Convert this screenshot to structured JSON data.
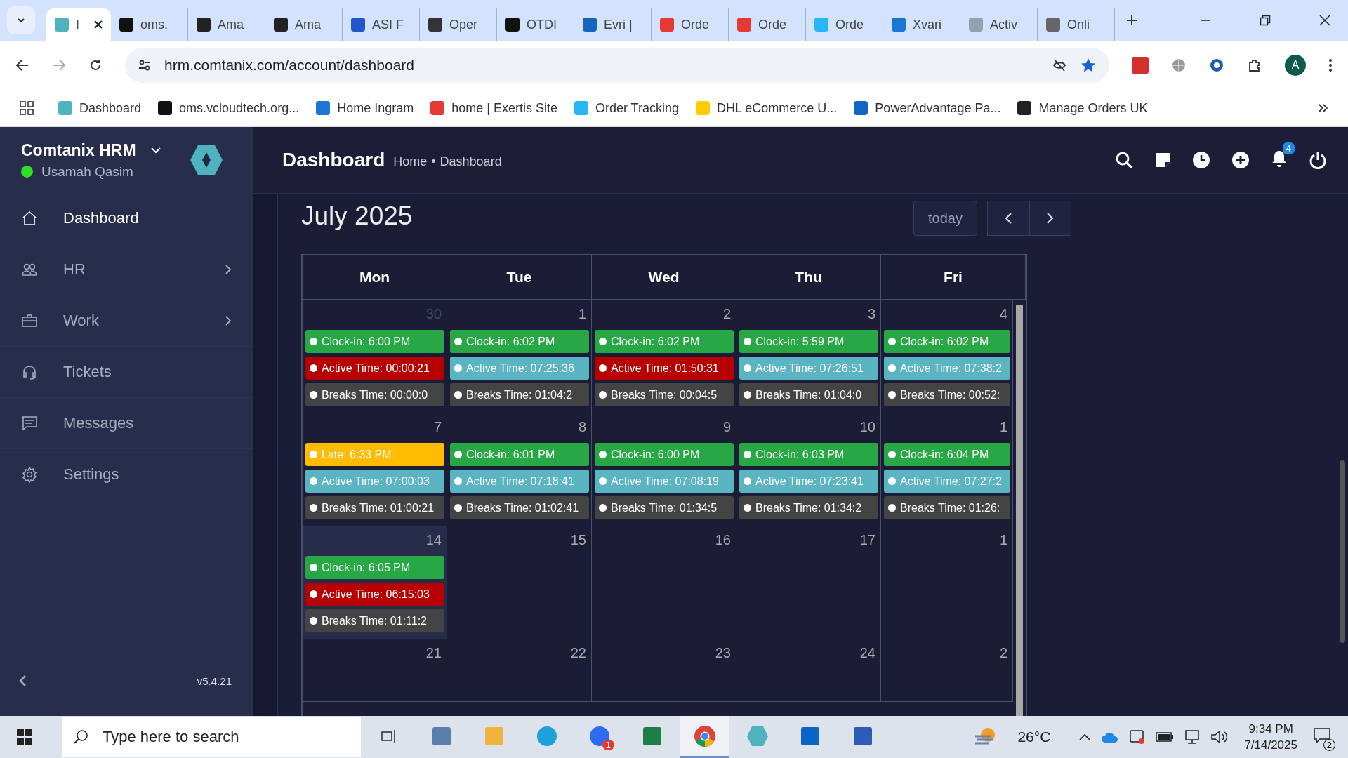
{
  "browser": {
    "tabs": [
      {
        "title": "I",
        "selected": true
      },
      {
        "title": "oms.",
        "selected": false
      },
      {
        "title": "Ama",
        "selected": false
      },
      {
        "title": "Ama",
        "selected": false
      },
      {
        "title": "ASI F",
        "selected": false
      },
      {
        "title": "Oper",
        "selected": false
      },
      {
        "title": "OTDI",
        "selected": false
      },
      {
        "title": "Evri |",
        "selected": false
      },
      {
        "title": "Orde",
        "selected": false
      },
      {
        "title": "Orde",
        "selected": false
      },
      {
        "title": "Orde",
        "selected": false
      },
      {
        "title": "Xvari",
        "selected": false
      },
      {
        "title": "Activ",
        "selected": false
      },
      {
        "title": "Onli",
        "selected": false
      }
    ],
    "address": "hrm.comtanix.com/account/dashboard",
    "profile": "A",
    "bookmarks": [
      "Dashboard",
      "oms.vcloudtech.org...",
      "Home Ingram",
      "home | Exertis Site",
      "Order Tracking",
      "DHL eCommerce U...",
      "PowerAdvantage Pa...",
      "Manage Orders UK"
    ]
  },
  "sidebar": {
    "brand": "Comtanix HRM",
    "user": "Usamah Qasim",
    "online": true,
    "items": [
      {
        "label": "Dashboard",
        "kind": "home",
        "selected": true,
        "submenu": false
      },
      {
        "label": "HR",
        "kind": "people",
        "selected": false,
        "submenu": true
      },
      {
        "label": "Work",
        "kind": "briefcase",
        "selected": false,
        "submenu": true
      },
      {
        "label": "Tickets",
        "kind": "headset",
        "selected": false,
        "submenu": false
      },
      {
        "label": "Messages",
        "kind": "chat",
        "selected": false,
        "submenu": false
      },
      {
        "label": "Settings",
        "kind": "gear",
        "selected": false,
        "submenu": false
      }
    ],
    "version": "v5.4.21"
  },
  "header": {
    "title": "Dashboard",
    "breadcrumb": [
      "Home",
      "•",
      "Dashboard"
    ],
    "notification_count": "4"
  },
  "calendar": {
    "title": "July 2025",
    "today_button": "today",
    "weekdays": [
      "Mon",
      "Tue",
      "Wed",
      "Thu",
      "Fri"
    ],
    "weeks": [
      [
        {
          "day": "30",
          "outside": true,
          "today": false,
          "events": [
            {
              "text": "Clock-in: 6:00 PM",
              "color": "#28a745"
            },
            {
              "text": "Active Time: 00:00:21",
              "color": "#b70000"
            },
            {
              "text": "Breaks Time: 00:00:0",
              "color": "#444444"
            }
          ]
        },
        {
          "day": "1",
          "outside": false,
          "today": false,
          "events": [
            {
              "text": "Clock-in: 6:02 PM",
              "color": "#28a745"
            },
            {
              "text": "Active Time: 07:25:36",
              "color": "#5ab4c2"
            },
            {
              "text": "Breaks Time: 01:04:2",
              "color": "#444444"
            }
          ]
        },
        {
          "day": "2",
          "outside": false,
          "today": false,
          "events": [
            {
              "text": "Clock-in: 6:02 PM",
              "color": "#28a745"
            },
            {
              "text": "Active Time: 01:50:31",
              "color": "#b70000"
            },
            {
              "text": "Breaks Time: 00:04:5",
              "color": "#444444"
            }
          ]
        },
        {
          "day": "3",
          "outside": false,
          "today": false,
          "events": [
            {
              "text": "Clock-in: 5:59 PM",
              "color": "#28a745"
            },
            {
              "text": "Active Time: 07:26:51",
              "color": "#5ab4c2"
            },
            {
              "text": "Breaks Time: 01:04:0",
              "color": "#444444"
            }
          ]
        },
        {
          "day": "4",
          "outside": false,
          "today": false,
          "events": [
            {
              "text": "Clock-in: 6:02 PM",
              "color": "#28a745"
            },
            {
              "text": "Active Time: 07:38:2",
              "color": "#5ab4c2"
            },
            {
              "text": "Breaks Time: 00:52:",
              "color": "#444444"
            }
          ]
        }
      ],
      [
        {
          "day": "7",
          "outside": false,
          "today": false,
          "events": [
            {
              "text": "Late: 6:33 PM",
              "color": "#ffbb00"
            },
            {
              "text": "Active Time: 07:00:03",
              "color": "#5ab4c2"
            },
            {
              "text": "Breaks Time: 01:00:21",
              "color": "#444444"
            }
          ]
        },
        {
          "day": "8",
          "outside": false,
          "today": false,
          "events": [
            {
              "text": "Clock-in: 6:01 PM",
              "color": "#28a745"
            },
            {
              "text": "Active Time: 07:18:41",
              "color": "#5ab4c2"
            },
            {
              "text": "Breaks Time: 01:02:41",
              "color": "#444444"
            }
          ]
        },
        {
          "day": "9",
          "outside": false,
          "today": false,
          "events": [
            {
              "text": "Clock-in: 6:00 PM",
              "color": "#28a745"
            },
            {
              "text": "Active Time: 07:08:19",
              "color": "#5ab4c2"
            },
            {
              "text": "Breaks Time: 01:34:5",
              "color": "#444444"
            }
          ]
        },
        {
          "day": "10",
          "outside": false,
          "today": false,
          "events": [
            {
              "text": "Clock-in: 6:03 PM",
              "color": "#28a745"
            },
            {
              "text": "Active Time: 07:23:41",
              "color": "#5ab4c2"
            },
            {
              "text": "Breaks Time: 01:34:2",
              "color": "#444444"
            }
          ]
        },
        {
          "day": "1",
          "outside": false,
          "today": false,
          "events": [
            {
              "text": "Clock-in: 6:04 PM",
              "color": "#28a745"
            },
            {
              "text": "Active Time: 07:27:2",
              "color": "#5ab4c2"
            },
            {
              "text": "Breaks Time: 01:26:",
              "color": "#444444"
            }
          ]
        }
      ],
      [
        {
          "day": "14",
          "outside": false,
          "today": true,
          "events": [
            {
              "text": "Clock-in: 6:05 PM",
              "color": "#28a745"
            },
            {
              "text": "Active Time: 06:15:03",
              "color": "#b70000"
            },
            {
              "text": "Breaks Time: 01:11:2",
              "color": "#444444"
            }
          ]
        },
        {
          "day": "15",
          "outside": false,
          "today": false
        },
        {
          "day": "16",
          "outside": false,
          "today": false
        },
        {
          "day": "17",
          "outside": false,
          "today": false
        },
        {
          "day": "1",
          "outside": false,
          "today": false
        }
      ],
      [
        {
          "day": "21",
          "outside": false,
          "today": false
        },
        {
          "day": "22",
          "outside": false,
          "today": false
        },
        {
          "day": "23",
          "outside": false,
          "today": false
        },
        {
          "day": "24",
          "outside": false,
          "today": false
        },
        {
          "day": "2",
          "outside": false,
          "today": false
        }
      ]
    ]
  },
  "taskbar": {
    "search_placeholder": "Type here to search",
    "apps": [
      {
        "kind": "task-view",
        "selected": false
      },
      {
        "kind": "calculator",
        "selected": false
      },
      {
        "kind": "folder",
        "selected": false
      },
      {
        "kind": "edge",
        "selected": false
      },
      {
        "kind": "video",
        "selected": false,
        "badge": "1"
      },
      {
        "kind": "spreadsheet",
        "selected": false
      },
      {
        "kind": "chrome",
        "selected": true
      },
      {
        "kind": "hexagon",
        "selected": false
      },
      {
        "kind": "mail",
        "selected": false
      },
      {
        "kind": "document",
        "selected": false
      }
    ],
    "temperature": "26°C",
    "time": "9:34 PM",
    "date": "7/14/2025",
    "notifications": "2"
  }
}
